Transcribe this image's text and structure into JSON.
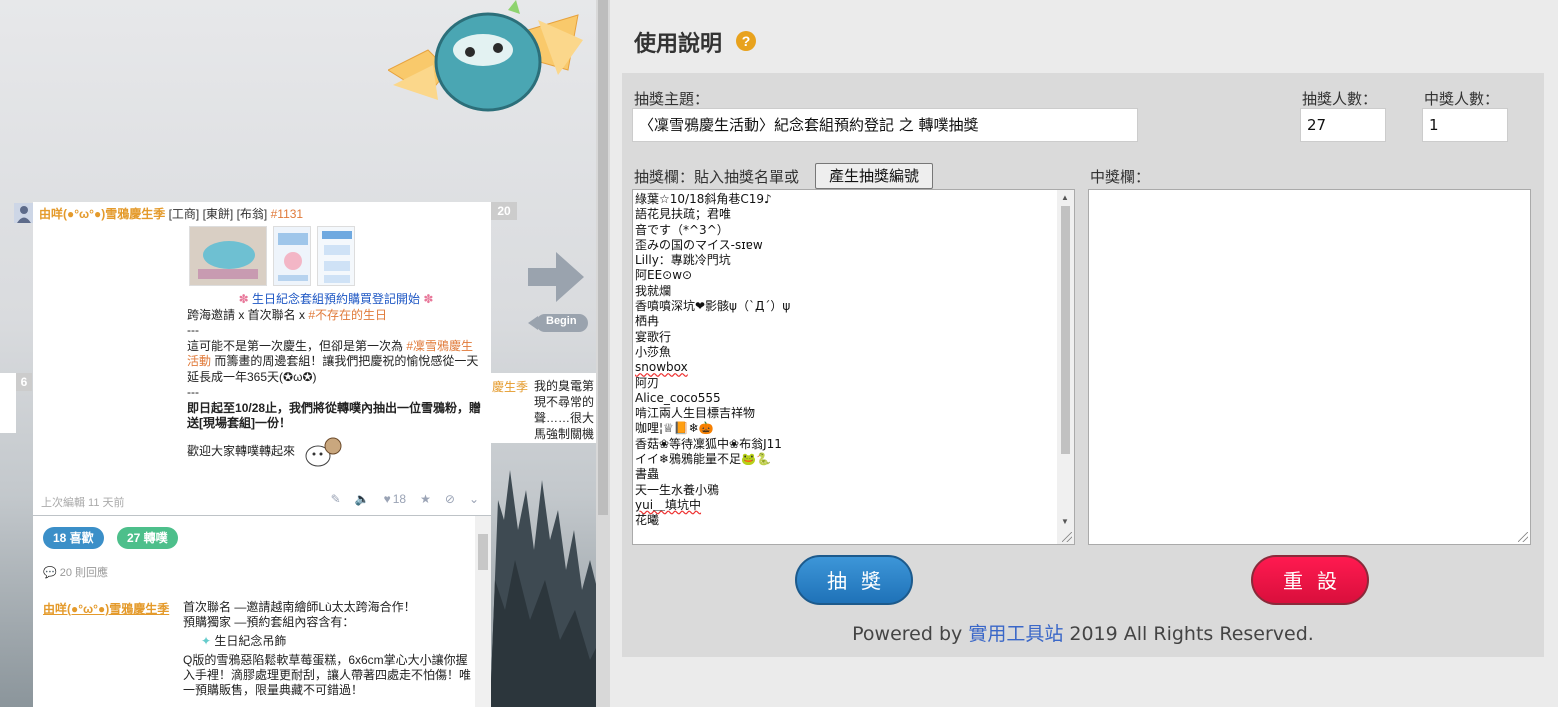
{
  "left": {
    "main_plurk": {
      "number": "20",
      "author": "由咩(●°ω°●)雪鴉慶生季",
      "qualifier": "[工商] [東餅] [布翁]",
      "tag": "#1131",
      "line1_pre": "生日紀念套組預約購買登記開始",
      "line2_a": "跨海邀請 x 首次聯名 x ",
      "line2_b": "#不存在的生日",
      "line3": "---",
      "line4_a": "這可能不是第一次慶生，但卻是第一次為 ",
      "line4_b": "#凜雪鴉慶生活動",
      "line4_c": " 而籌畫的周邊套組！讓我們把慶祝的愉悅感從一天延長成一年365天(✪ω✪)",
      "line5": "---",
      "line6_a": "即日起至",
      "line6_b": "10/28",
      "line6_c": "止，我們將從轉噗內抽出一位雪鴉粉，贈送[現場套組]一份！",
      "line7": "歡迎大家轉噗轉起來",
      "footer": "上次編輯 11 天前",
      "likes": "18"
    },
    "responses": {
      "likes_pill": "18 喜歡",
      "replurk_pill": "27 轉噗",
      "count": "20 則回應",
      "author": "由咩(●°ω°●)雪鴉慶生季",
      "text_1": "首次聯名 —邀請越南繪師Lù太太跨海合作！",
      "text_2": "預購獨家 —預約套組內容含有：",
      "text_3": "生日紀念吊飾",
      "text_4": "Q版的雪鴉惡陷鬆軟草莓蛋糕，6x6cm掌心大小讓你握入手裡！滴膠處理更耐刮，讓人帶著四處走不怕傷！唯一預購販售，限量典藏不可錯過！"
    },
    "side_plurk": {
      "author": "慶生季",
      "lines": [
        "我的臭電第",
        "現不尋常的",
        "聲……很大",
        "馬強制關機"
      ]
    },
    "mini_number": "6",
    "begin_label": "Begin"
  },
  "right": {
    "title": "使用說明",
    "help": "?",
    "topic_label": "抽獎主題：",
    "topic_value": "〈凜雪鴉慶生活動〉紀念套組預約登記 之 轉噗抽獎",
    "entrants_label": "抽獎人數：",
    "entrants_value": "27",
    "winners_label": "中獎人數：",
    "winners_value": "1",
    "entries_label": "抽獎欄：貼入抽獎名單或",
    "generate_btn": "產生抽獎編號",
    "winner_label": "中獎欄：",
    "entries": [
      "綠葉☆10/18斜角巷C19♪",
      "語花見扶疏；君唯",
      "音です（*^3^）",
      "歪みの国のマイス-sɪɐw",
      "Lilly：專跳冷門坑",
      "阿EE⊙w⊙",
      "我就爛",
      "香噴噴深坑❤影骸ψ（`Д´）ψ",
      "栖冉",
      "宴歌行",
      "小莎魚",
      "snowbox",
      "阿刃",
      "Alice_coco555",
      "啃江兩人生目標吉祥物",
      "咖哩¦♕📙❄🎃",
      "香菇❀等待凜狐中❀布翁J11",
      "イイ❄鴉鴉能量不足🐸🐍",
      "書蟲",
      "天一生水養小鴉",
      "yui＿填坑中",
      "花曦"
    ],
    "draw_btn": "抽獎",
    "reset_btn": "重設",
    "footer_pre": "Powered by ",
    "footer_link": "實用工具站",
    "footer_post": " 2019 All Rights Reserved.",
    "colors": {
      "draw": "#2a82c9",
      "reset": "#f2154a",
      "link": "#3a67c8",
      "orange": "#e8a21d"
    }
  }
}
